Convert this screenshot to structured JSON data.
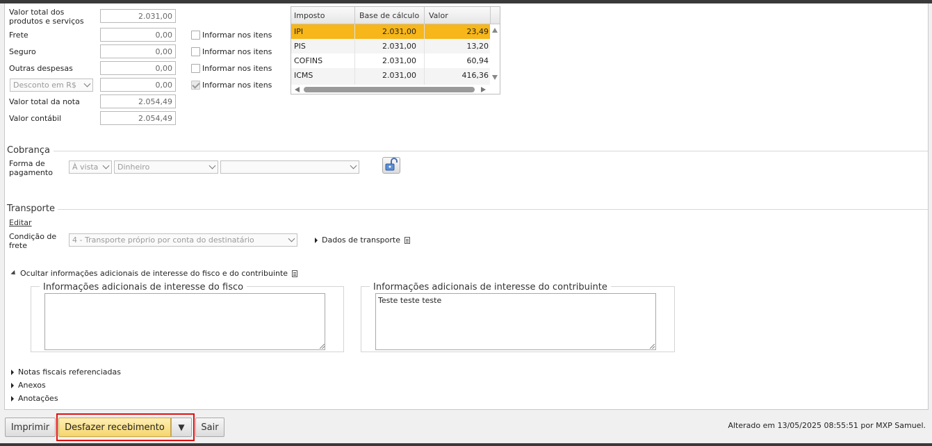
{
  "totals": {
    "rows": [
      {
        "label": "Valor total dos produtos e serviços",
        "value": "2.031,00",
        "checkbox_label": ""
      },
      {
        "label": "Frete",
        "value": "0,00",
        "checkbox_label": "Informar nos itens"
      },
      {
        "label": "Seguro",
        "value": "0,00",
        "checkbox_label": "Informar nos itens"
      },
      {
        "label": "Outras despesas",
        "value": "0,00",
        "checkbox_label": "Informar nos itens"
      },
      {
        "label": "Desconto em R$",
        "value": "0,00",
        "checkbox_label": "Informar nos itens"
      },
      {
        "label": "Valor total da nota",
        "value": "2.054,49"
      },
      {
        "label": "Valor contábil",
        "value": "2.054,49"
      }
    ]
  },
  "tax_grid": {
    "columns": [
      "Imposto",
      "Base de cálculo",
      "Valor"
    ],
    "rows": [
      {
        "imposto": "IPI",
        "base": "2.031,00",
        "valor": "23,49",
        "selected": true
      },
      {
        "imposto": "PIS",
        "base": "2.031,00",
        "valor": "13,20",
        "selected": false
      },
      {
        "imposto": "COFINS",
        "base": "2.031,00",
        "valor": "60,94",
        "selected": false
      },
      {
        "imposto": "ICMS",
        "base": "2.031,00",
        "valor": "416,36",
        "selected": false
      }
    ]
  },
  "cobranca": {
    "title": "Cobrança",
    "forma_label": "Forma de pagamento",
    "condicao": "À vista",
    "meio": "Dinheiro",
    "extra": ""
  },
  "transporte": {
    "title": "Transporte",
    "edit_link": "Editar",
    "condicao_label": "Condição de frete",
    "condicao_value": "4 - Transporte próprio por conta do destinatário",
    "dados_label": "Dados de transporte"
  },
  "info_adicionais": {
    "toggle_label": "Ocultar informações adicionais de interesse do fisco e do contribuinte",
    "fisco_title": "Informações adicionais de interesse do fisco",
    "fisco_value": "",
    "contribuinte_title": "Informações adicionais de interesse do contribuinte",
    "contribuinte_value": "Teste teste teste"
  },
  "collapsibles": [
    "Notas fiscais referenciadas",
    "Anexos",
    "Anotações"
  ],
  "footer": {
    "print_label": "Imprimir",
    "undo_label": "Desfazer recebimento",
    "dropdown_glyph": "▼",
    "exit_label": "Sair",
    "status_text": "Alterado em 13/05/2025 08:55:51 por MXP Samuel."
  },
  "colors": {
    "selected_row": "#f7b619",
    "primary_button": "#f5d66c",
    "highlight_outline": "#e01010"
  }
}
